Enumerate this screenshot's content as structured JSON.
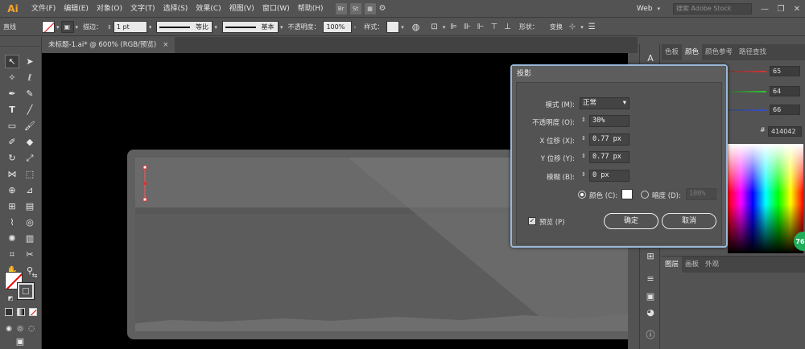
{
  "app": {
    "logo": "Ai",
    "workspace": "Web",
    "search_placeholder": "搜索 Adobe Stock"
  },
  "menu": [
    "文件(F)",
    "编辑(E)",
    "对象(O)",
    "文字(T)",
    "选择(S)",
    "效果(C)",
    "视图(V)",
    "窗口(W)",
    "帮助(H)"
  ],
  "menu_icons": {
    "br": "Br",
    "st": "St"
  },
  "control": {
    "object_type": "直线",
    "stroke_label": "描边：",
    "stroke_weight": "1 pt",
    "profile": "等比",
    "brush": "基本",
    "opacity_label": "不透明度：",
    "opacity": "100%",
    "style_label": "样式：",
    "shape_label": "形状：",
    "transform_label": "变换"
  },
  "tab": {
    "title": "未标题-1.ai* @ 600% (RGB/预览)",
    "close": "×"
  },
  "color_panel": {
    "tabs": [
      "色板",
      "颜色",
      "颜色参考",
      "路径查找"
    ],
    "active_tab": "颜色",
    "r": "65",
    "g": "64",
    "b": "66",
    "hex_label": "#",
    "hex": "414042",
    "badge": "76"
  },
  "layers_panel": {
    "tabs": [
      "图层",
      "画板",
      "外观"
    ]
  },
  "dialog": {
    "title": "投影",
    "mode_label": "模式 (M):",
    "mode": "正常",
    "opacity_label": "不透明度 (O):",
    "opacity": "30%",
    "xoffset_label": "X 位移 (X):",
    "xoffset": "0.77 px",
    "yoffset_label": "Y 位移 (Y):",
    "yoffset": "0.77 px",
    "blur_label": "模糊 (B):",
    "blur": "0 px",
    "color_label": "颜色 (C):",
    "darkness_label": "暗度 (D):",
    "darkness": "100%",
    "preview_label": "预览 (P)",
    "ok": "确定",
    "cancel": "取消"
  },
  "colors": {
    "ui_bg": "#535353",
    "canvas": "#000000",
    "dialog_border": "#9ab8d8",
    "logo": "#f7a52a"
  }
}
